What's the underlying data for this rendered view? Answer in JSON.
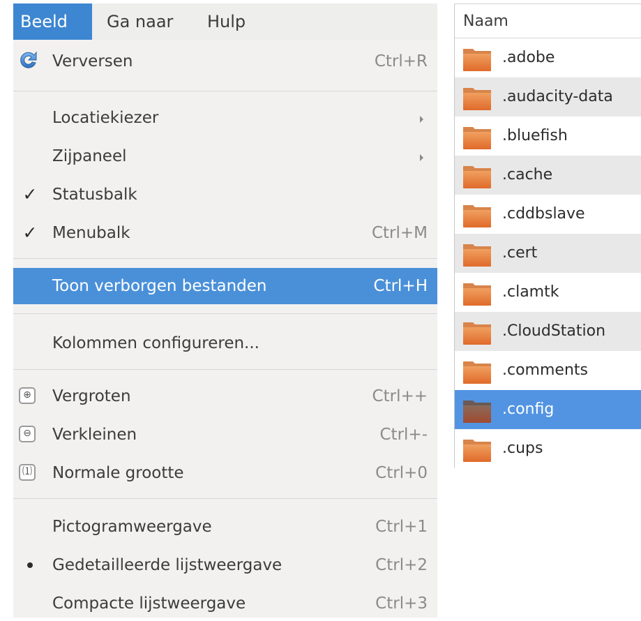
{
  "menubar": {
    "items": [
      {
        "label": "Beeld",
        "active": true
      },
      {
        "label": "Ga naar",
        "active": false
      },
      {
        "label": "Hulp",
        "active": false
      }
    ]
  },
  "menu": {
    "items": [
      {
        "label": "Verversen",
        "accel": "Ctrl+R",
        "icon": "refresh-icon"
      },
      {
        "label": "Locatiekiezer",
        "submenu": true
      },
      {
        "label": "Zijpaneel",
        "submenu": true
      },
      {
        "label": "Statusbalk",
        "checked": true
      },
      {
        "label": "Menubalk",
        "accel": "Ctrl+M",
        "checked": true
      },
      {
        "label": "Toon verborgen bestanden",
        "accel": "Ctrl+H",
        "highlighted": true
      },
      {
        "label": "Kolommen configureren..."
      },
      {
        "label": "Vergroten",
        "accel": "Ctrl++",
        "icon": "zoom-in-icon"
      },
      {
        "label": "Verkleinen",
        "accel": "Ctrl+-",
        "icon": "zoom-out-icon"
      },
      {
        "label": "Normale grootte",
        "accel": "Ctrl+0",
        "icon": "zoom-original-icon"
      },
      {
        "label": "Pictogramweergave",
        "accel": "Ctrl+1"
      },
      {
        "label": "Gedetailleerde lijstweergave",
        "accel": "Ctrl+2",
        "radio_selected": true
      },
      {
        "label": "Compacte lijstweergave",
        "accel": "Ctrl+3"
      }
    ]
  },
  "filelist": {
    "header": "Naam",
    "rows": [
      {
        "name": ".adobe"
      },
      {
        "name": ".audacity-data"
      },
      {
        "name": ".bluefish"
      },
      {
        "name": ".cache"
      },
      {
        "name": ".cddbslave"
      },
      {
        "name": ".cert"
      },
      {
        "name": ".clamtk"
      },
      {
        "name": ".CloudStation"
      },
      {
        "name": ".comments"
      },
      {
        "name": ".config",
        "selected": true
      },
      {
        "name": ".cups"
      }
    ]
  },
  "colors": {
    "accent": "#4a90d9",
    "menubar_active": "#3d86d1",
    "selection": "#5294e2",
    "folder": "#e8783a"
  }
}
